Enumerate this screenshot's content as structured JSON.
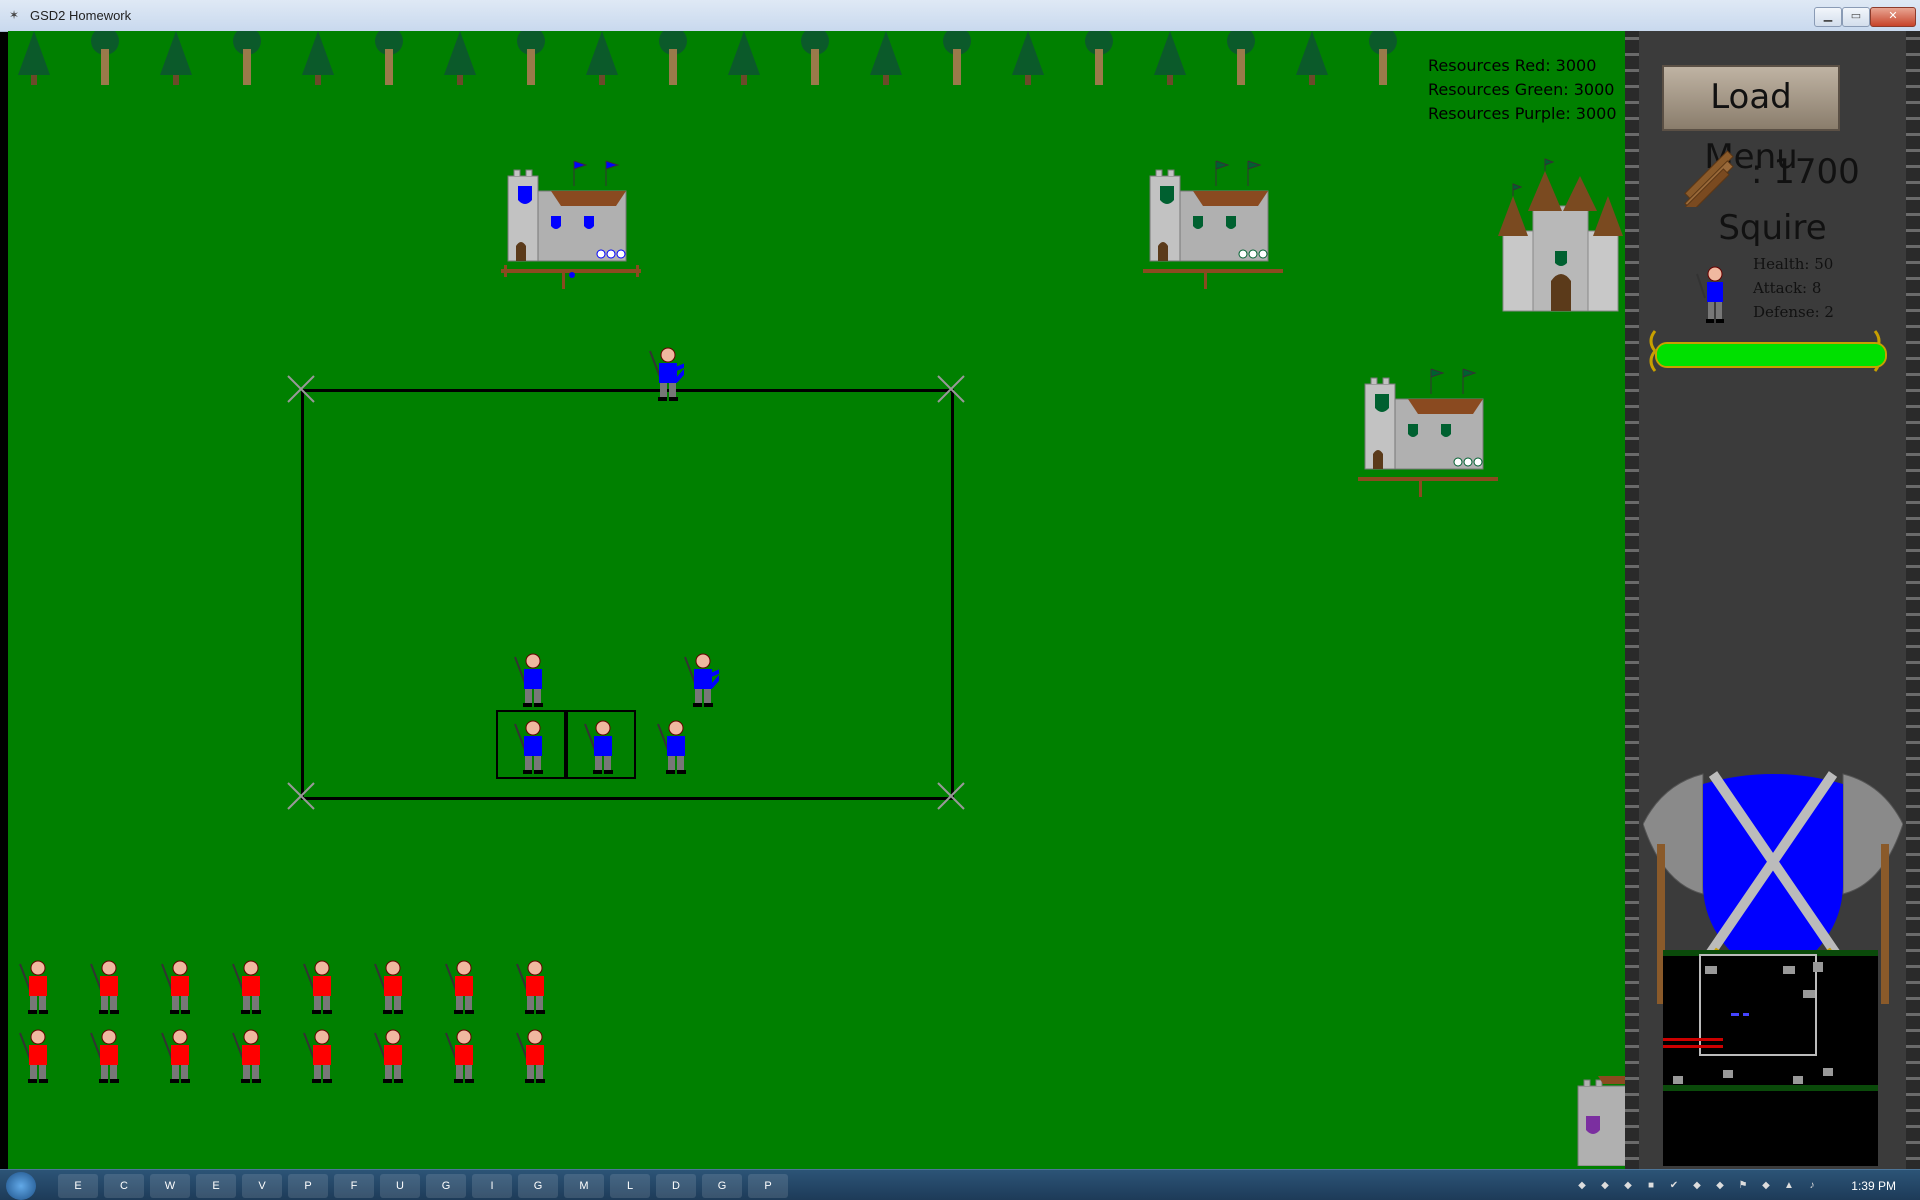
{
  "window": {
    "title": "GSD2 Homework",
    "minimize_icon": "minimize-icon",
    "maximize_icon": "maximize-icon",
    "close_icon": "close-icon"
  },
  "resources": {
    "red": "Resources Red: 3000",
    "green": "Resources Green: 3000",
    "purple": "Resources Purple: 3000"
  },
  "hud": {
    "load_menu_label": "Load Menu",
    "wood_count": ": 1700",
    "selected_unit": {
      "name": "Squire",
      "health": "Health: 50",
      "attack": "Attack: 8",
      "defense": "Defense: 2",
      "health_fraction": 1.0
    }
  },
  "colors": {
    "grass": "#008000",
    "blue_team": "#0000ff",
    "red_team": "#ff0000",
    "green_team": "#006030",
    "purple_team": "#7b2fa0",
    "health_bar": "#00e000"
  },
  "taskbar": {
    "apps": [
      "Explorer",
      "Chrome",
      "Word",
      "Excel",
      "Visual Studio",
      "Photoshop",
      "Flash",
      "Unity",
      "GIMP",
      "Inkscape",
      "Game",
      "Minecraft",
      "League",
      "Dota 2",
      "GSD2 Homework",
      "Paint"
    ],
    "clock": "1:39 PM"
  }
}
